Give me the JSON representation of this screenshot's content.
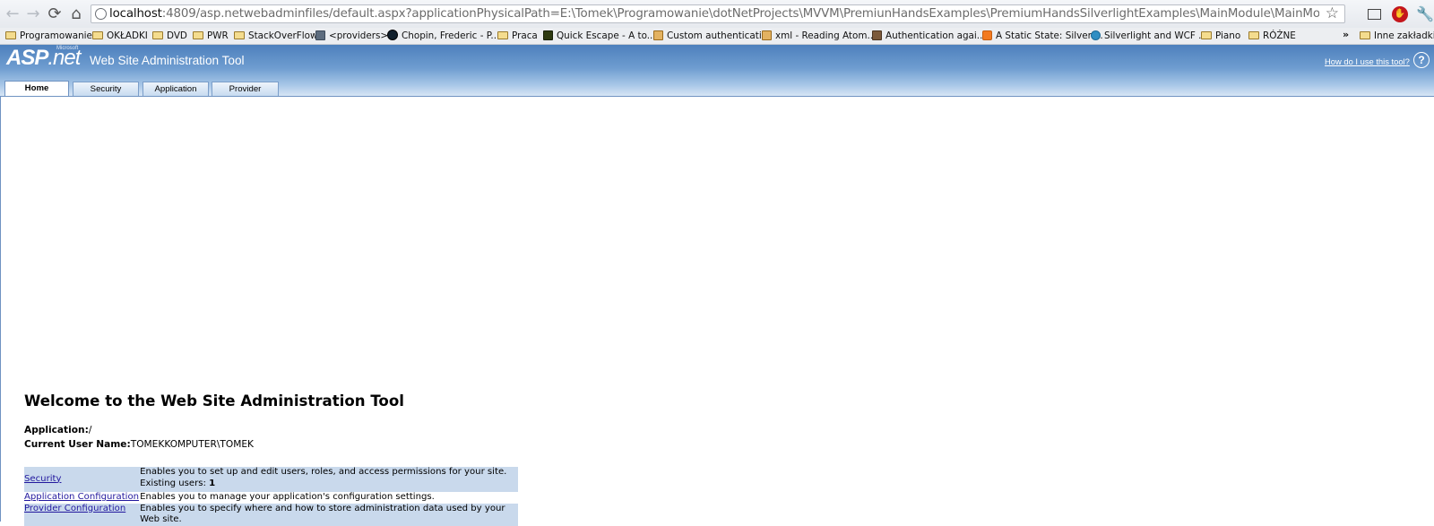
{
  "browser": {
    "url_host": "localhost",
    "url_rest": ":4809/asp.netwebadminfiles/default.aspx?applicationPhysicalPath=E:\\Tomek\\Programowanie\\dotNetProjects\\MVVM\\PremiunHandsExamples\\PremiumHandsSilverlightExamples\\MainModule\\MainModule.Web&applicationUrl=/",
    "bookmarks": [
      {
        "label": "Programowanie",
        "icon": "folder-icon"
      },
      {
        "label": "OKŁADKI",
        "icon": "folder-icon"
      },
      {
        "label": "DVD",
        "icon": "folder-icon"
      },
      {
        "label": "PWR",
        "icon": "folder-icon"
      },
      {
        "label": "StackOverFlow",
        "icon": "folder-icon"
      },
      {
        "label": "<providers>",
        "icon": "site-icon"
      },
      {
        "label": "Chopin, Frederic - P...",
        "icon": "site-icon"
      },
      {
        "label": "Praca",
        "icon": "folder-icon"
      },
      {
        "label": "Quick Escape - A to...",
        "icon": "site-icon"
      },
      {
        "label": "Custom authenticati...",
        "icon": "stackoverflow-icon"
      },
      {
        "label": "xml - Reading Atom...",
        "icon": "stackoverflow-icon"
      },
      {
        "label": "Authentication agai...",
        "icon": "site-icon"
      },
      {
        "label": "A Static State: Silverl...",
        "icon": "blogger-icon"
      },
      {
        "label": "Silverlight and WCF ...",
        "icon": "site-icon"
      },
      {
        "label": "Piano",
        "icon": "folder-icon"
      },
      {
        "label": "RÓŻNE",
        "icon": "folder-icon"
      }
    ],
    "other_bookmarks": "Inne zakładki",
    "chevron": "»"
  },
  "header": {
    "logo_asp": "ASP",
    "logo_net": ".net",
    "logo_ms": "Microsoft",
    "title": "Web Site Administration Tool",
    "help_link": "How do I use this tool?",
    "help_icon": "?"
  },
  "tabs": [
    {
      "label": "Home",
      "active": true
    },
    {
      "label": "Security",
      "active": false
    },
    {
      "label": "Application",
      "active": false
    },
    {
      "label": "Provider",
      "active": false
    }
  ],
  "main": {
    "heading": "Welcome to the Web Site Administration Tool",
    "application_label": "Application:",
    "application_value": "/",
    "user_label": "Current User Name:",
    "user_value": "TOMEKKOMPUTER\\TOMEK",
    "rows": [
      {
        "link": "Security",
        "desc": "Enables you to set up and edit users, roles, and access permissions for your site.",
        "extra_label": "Existing users: ",
        "extra_value": "1"
      },
      {
        "link": "Application Configuration",
        "desc": "Enables you to manage your application's configuration settings."
      },
      {
        "link": "Provider Configuration",
        "desc": "Enables you to specify where and how to store administration data used by your Web site."
      }
    ]
  },
  "colors": {
    "header_blue": "#4d80bd",
    "row_shade": "#c9d9ec",
    "link": "#22189e"
  }
}
